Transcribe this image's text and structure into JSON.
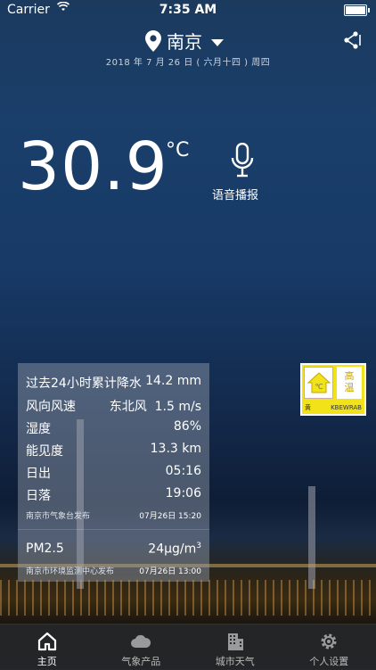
{
  "status_bar": {
    "carrier": "Carrier",
    "time": "7:35 AM"
  },
  "header": {
    "city": "南京",
    "date": "2018 年 7 月 26 日 ( 六月十四 ) 周四"
  },
  "weather": {
    "temperature": "30.9",
    "unit": "°C",
    "voice_label": "语音播报"
  },
  "warning": {
    "icon_text": "℃",
    "title_line1": "高",
    "title_line2": "温",
    "footer_left": "黄",
    "footer_right": "KBEWRAB",
    "color": "#f1e21a"
  },
  "details": {
    "rows": [
      {
        "label": "过去24小时累计降水",
        "value": "14.2 mm"
      },
      {
        "label": "风向风速",
        "value": "东北风  1.5 m/s"
      },
      {
        "label": "湿度",
        "value": "86%"
      },
      {
        "label": "能见度",
        "value": "13.3 km"
      },
      {
        "label": "日出",
        "value": "05:16"
      },
      {
        "label": "日落",
        "value": "19:06"
      }
    ],
    "source1": {
      "name": "南京市气象台发布",
      "time": "07月26日 15:20"
    },
    "pm": {
      "label": "PM2.5",
      "value": "24",
      "unit": "μg/m",
      "unit_sup": "3"
    },
    "source2": {
      "name": "南京市环境监测中心发布",
      "time": "07月26日 13:00"
    }
  },
  "tabbar": {
    "tabs": [
      {
        "label": "主页",
        "icon": "home-icon",
        "active": true
      },
      {
        "label": "气象产品",
        "icon": "cloud-icon",
        "active": false
      },
      {
        "label": "城市天气",
        "icon": "building-icon",
        "active": false
      },
      {
        "label": "个人设置",
        "icon": "gear-icon",
        "active": false
      }
    ]
  }
}
